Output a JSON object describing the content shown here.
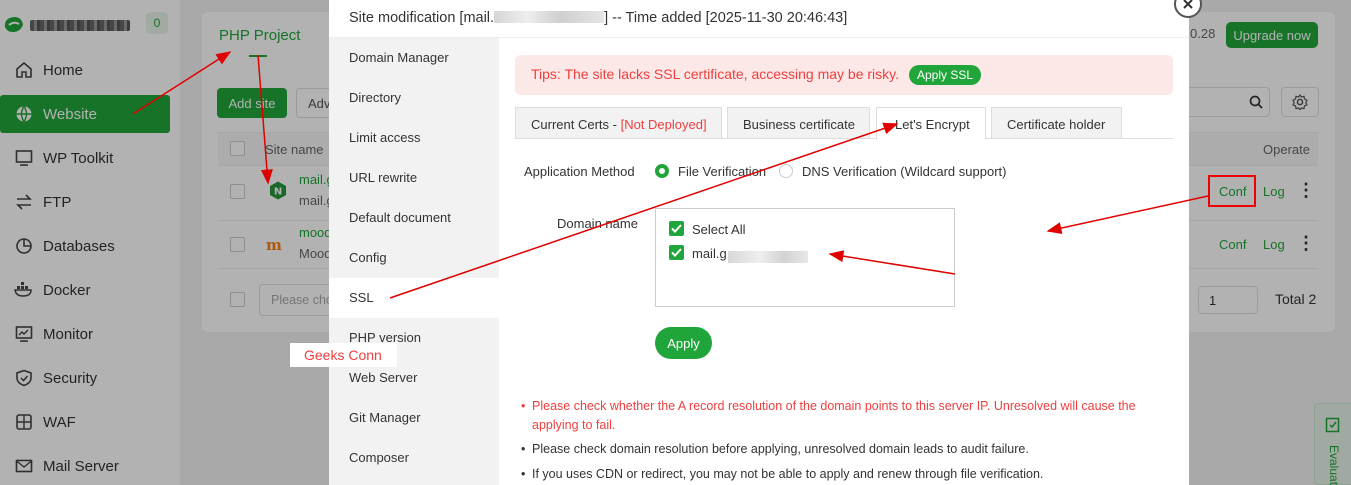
{
  "sidebar": {
    "badge": "0",
    "items": [
      {
        "label": "Home",
        "icon": "home-icon"
      },
      {
        "label": "Website",
        "icon": "globe-icon"
      },
      {
        "label": "WP Toolkit",
        "icon": "monitor-icon"
      },
      {
        "label": "FTP",
        "icon": "transfer-icon"
      },
      {
        "label": "Databases",
        "icon": "database-icon"
      },
      {
        "label": "Docker",
        "icon": "docker-icon"
      },
      {
        "label": "Monitor",
        "icon": "chart-icon"
      },
      {
        "label": "Security",
        "icon": "shield-icon"
      },
      {
        "label": "WAF",
        "icon": "waf-icon"
      },
      {
        "label": "Mail Server",
        "icon": "mail-icon"
      }
    ]
  },
  "header": {
    "version": "0.28",
    "upgrade_label": "Upgrade now"
  },
  "site_list": {
    "project_tab": "PHP Project",
    "add_site_label": "Add site",
    "advanced_label": "Adv",
    "col_site_name": "Site name",
    "col_operate": "Operate",
    "rows": [
      {
        "name": "mail.g",
        "subname": "mail.g",
        "conf": "Conf",
        "log": "Log"
      },
      {
        "name": "mood",
        "subname": "Mood",
        "conf": "Conf",
        "log": "Log"
      }
    ],
    "batch_placeholder": "Please cho",
    "page": "1",
    "total": "Total 2"
  },
  "modal": {
    "title_prefix": "Site modification [mail.",
    "title_suffix": "] -- Time added [2025-11-30 20:46:43]",
    "menu": [
      "Domain Manager",
      "Directory",
      "Limit access",
      "URL rewrite",
      "Default document",
      "Config",
      "SSL",
      "PHP version",
      "Web Server",
      "Git Manager",
      "Composer"
    ],
    "active_menu": "SSL",
    "tip_text": "Tips: The site lacks SSL certificate, accessing may be risky.",
    "apply_ssl_label": "Apply SSL",
    "tabs": {
      "current_certs": "Current Certs - ",
      "not_deployed": "[Not Deployed]",
      "business": "Business certificate",
      "lets_encrypt": "Let's Encrypt",
      "holder": "Certificate holder"
    },
    "method_label": "Application Method",
    "method_file": "File Verification",
    "method_dns": "DNS Verification (Wildcard support)",
    "domain_label": "Domain name",
    "select_all": "Select All",
    "domain_item": "mail.g",
    "apply_label": "Apply",
    "notes": [
      "Please check whether the A record resolution of the domain points to this server IP. Unresolved will cause the applying to fail.",
      "Please check domain resolution before applying, unresolved domain leads to audit failure.",
      "If you uses CDN or redirect, you may not be able to apply and renew through file verification."
    ]
  },
  "watermark": "Geeks Conn",
  "eval_tab": "Evaluat",
  "colors": {
    "brand_green": "#20a53a",
    "warning_red": "#ef3e3e",
    "annotation_red": "#e00000"
  }
}
